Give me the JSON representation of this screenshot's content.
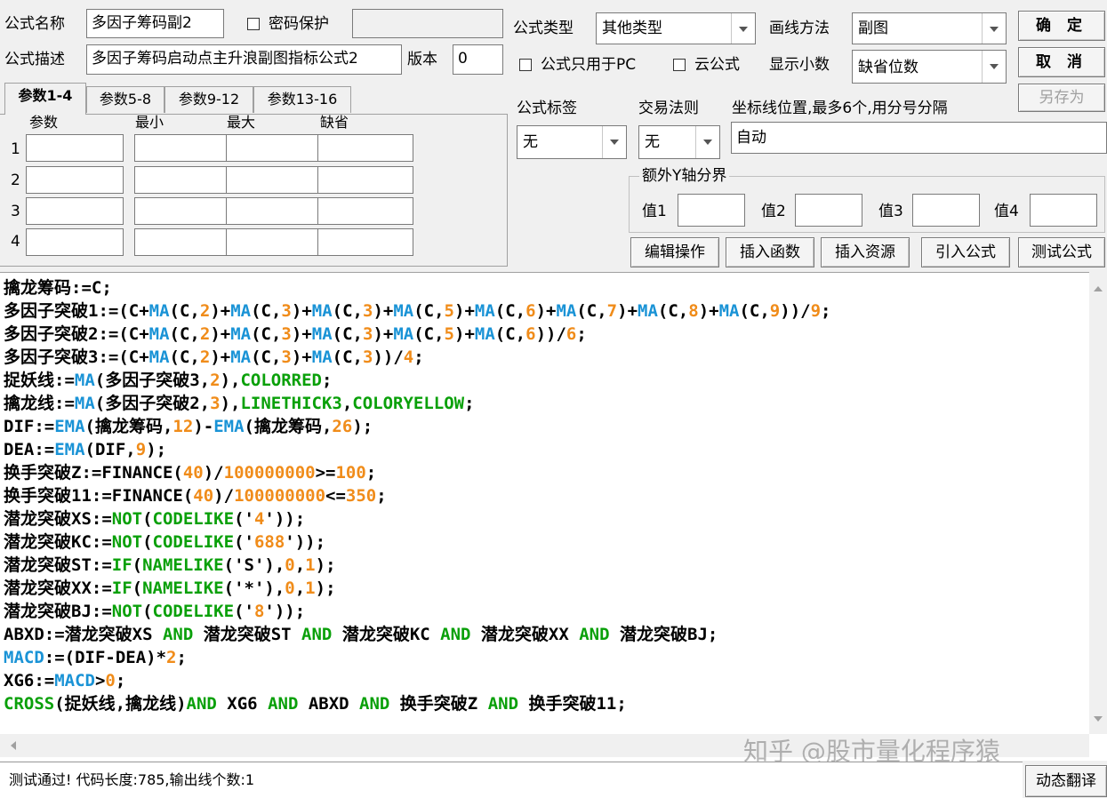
{
  "header": {
    "formula_name_label": "公式名称",
    "formula_name_value": "多因子筹码副2",
    "password_label": "密码保护",
    "formula_desc_label": "公式描述",
    "formula_desc_value": "多因子筹码启动点主升浪副图指标公式2",
    "version_label": "版本",
    "version_value": "0",
    "formula_type_label": "公式类型",
    "formula_type_value": "其他类型",
    "draw_method_label": "画线方法",
    "draw_method_value": "副图",
    "pc_only_label": "公式只用于PC",
    "cloud_label": "云公式",
    "decimals_label": "显示小数",
    "decimals_value": "缺省位数",
    "confirm_label": "确 定",
    "cancel_label": "取 消",
    "save_as_label": "另存为"
  },
  "params": {
    "tabs": [
      "参数1-4",
      "参数5-8",
      "参数9-12",
      "参数13-16"
    ],
    "columns": [
      "参数",
      "最小",
      "最大",
      "缺省"
    ],
    "rows": [
      "1",
      "2",
      "3",
      "4"
    ]
  },
  "right_panel": {
    "tag_label": "公式标签",
    "tag_value": "无",
    "trade_rule_label": "交易法则",
    "trade_rule_value": "无",
    "axis_label": "坐标线位置,最多6个,用分号分隔",
    "axis_value": "自动",
    "extra_y_label": "额外Y轴分界",
    "values": [
      "值1",
      "值2",
      "值3",
      "值4"
    ]
  },
  "toolbar": [
    "编辑操作",
    "插入函数",
    "插入资源",
    "引入公式",
    "测试公式"
  ],
  "status": {
    "message": "测试通过! 代码长度:785,输出线个数:1",
    "translate_label": "动态翻译"
  },
  "watermark": "知乎 @股市量化程序猿",
  "colors": {
    "keyword": "#0aa00a",
    "function": "#1a93d6",
    "number": "#f08c1a",
    "text": "#000000"
  },
  "code_lines": [
    "擒龙筹码:=C;",
    "多因子突破1:=(C+MA(C,2)+MA(C,3)+MA(C,3)+MA(C,5)+MA(C,6)+MA(C,7)+MA(C,8)+MA(C,9))/9;",
    "多因子突破2:=(C+MA(C,2)+MA(C,3)+MA(C,3)+MA(C,5)+MA(C,6))/6;",
    "多因子突破3:=(C+MA(C,2)+MA(C,3)+MA(C,3))/4;",
    "捉妖线:=MA(多因子突破3,2),COLORRED;",
    "擒龙线:=MA(多因子突破2,3),LINETHICK3,COLORYELLOW;",
    "DIF:=EMA(擒龙筹码,12)-EMA(擒龙筹码,26);",
    "DEA:=EMA(DIF,9);",
    "换手突破Z:=FINANCE(40)/100000000>=100;",
    "换手突破11:=FINANCE(40)/100000000<=350;",
    "潜龙突破XS:=NOT(CODELIKE('4'));",
    "潜龙突破KC:=NOT(CODELIKE('688'));",
    "潜龙突破ST:=IF(NAMELIKE('S'),0,1);",
    "潜龙突破XX:=IF(NAMELIKE('*'),0,1);",
    "潜龙突破BJ:=NOT(CODELIKE('8'));",
    "ABXD:=潜龙突破XS AND 潜龙突破ST AND 潜龙突破KC AND 潜龙突破XX AND 潜龙突破BJ;",
    "MACD:=(DIF-DEA)*2;",
    "XG6:=MACD>0;",
    "CROSS(捉妖线,擒龙线)AND XG6 AND ABXD AND 换手突破Z AND 换手突破11;"
  ]
}
